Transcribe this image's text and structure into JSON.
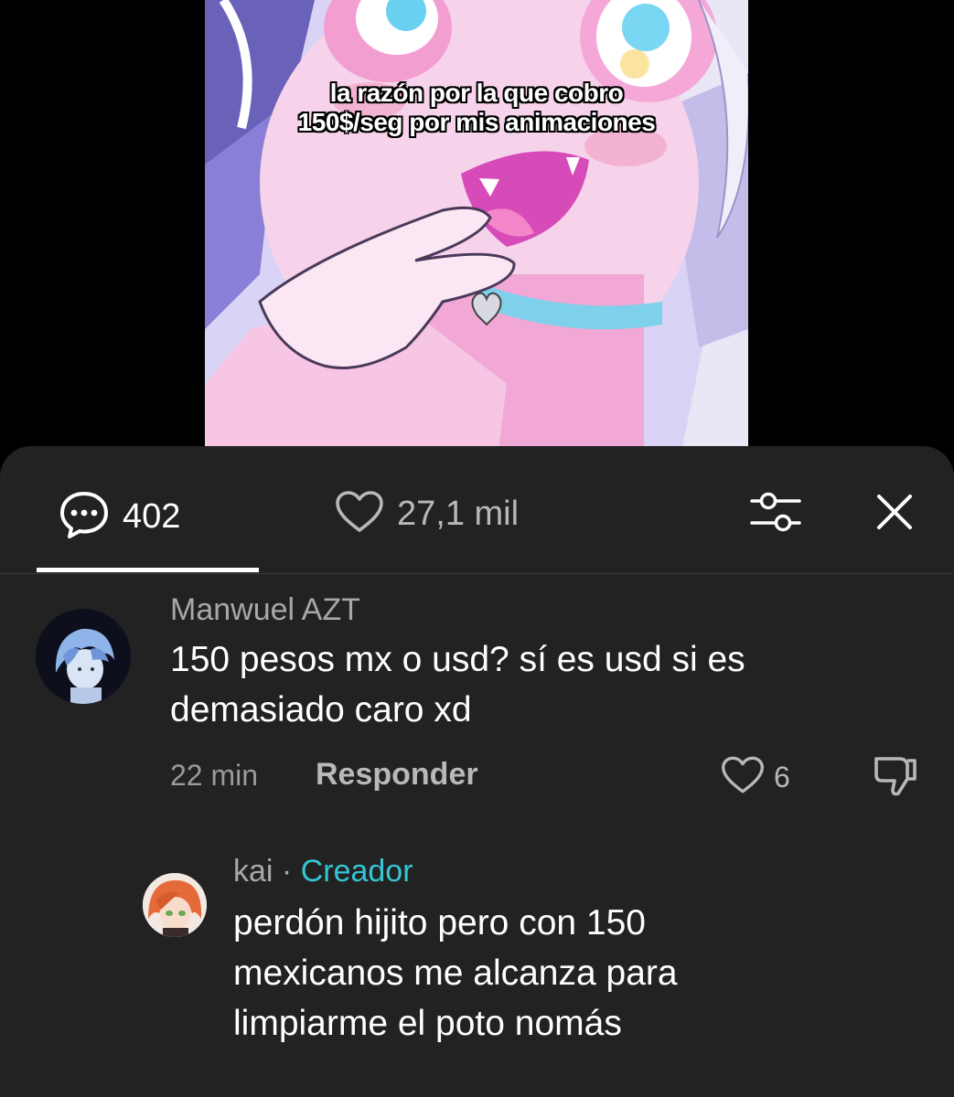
{
  "video": {
    "caption_line1": "la razón por la que cobro",
    "caption_line2": "150$/seg por mis animaciones"
  },
  "tabs": {
    "comments_count": "402",
    "likes_count": "27,1 mil",
    "comments_icon": "comment-bubble-icon",
    "likes_icon": "heart-icon"
  },
  "controls": {
    "filter_icon": "sliders-icon",
    "close_icon": "close-icon"
  },
  "comments": [
    {
      "username": "Manwuel AZT",
      "text_lines": [
        "150 pesos mx o usd? sí es usd si es",
        "demasiado caro xd"
      ],
      "time": "22 min",
      "reply_label": "Responder",
      "likes": "6"
    },
    {
      "username": "kai",
      "separator": "·",
      "badge": "Creador",
      "text_lines": [
        "perdón hijito pero con 150",
        "mexicanos me alcanza para",
        "limpiarme el poto nomás"
      ]
    }
  ],
  "colors": {
    "panel_bg": "#222222",
    "creator_badge": "#35c6d6",
    "text_primary": "#ffffff",
    "text_secondary": "#a8a8a8"
  }
}
